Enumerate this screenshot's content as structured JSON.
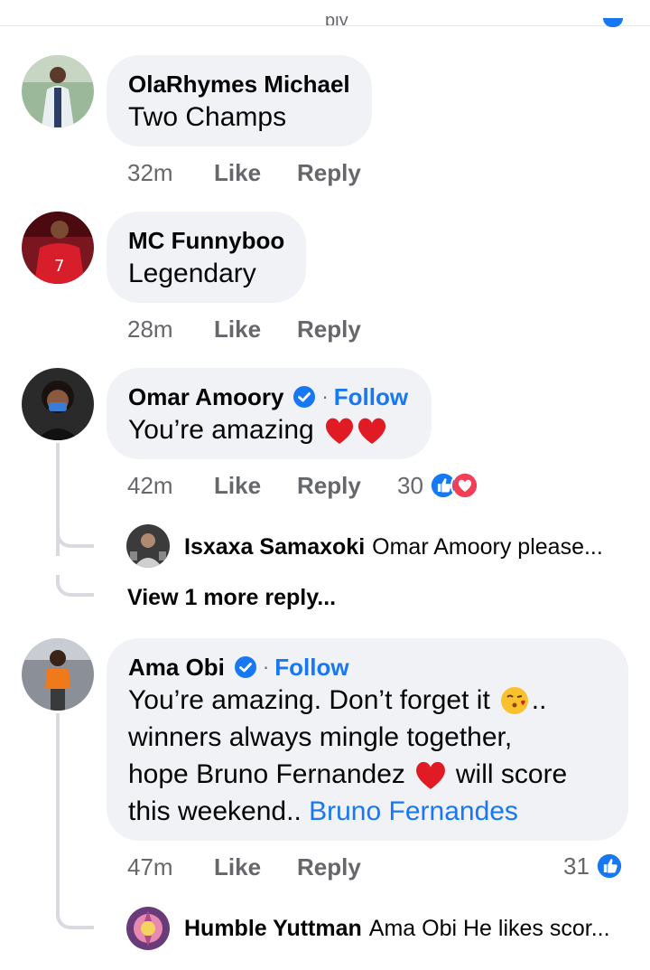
{
  "top": {
    "remnant_text": "ply"
  },
  "comments": [
    {
      "author": "OlaRhymes Michael",
      "text": "Two Champs",
      "time": "32m",
      "like": "Like",
      "reply": "Reply"
    },
    {
      "author": "MC Funnyboo",
      "text": "Legendary",
      "time": "28m",
      "like": "Like",
      "reply": "Reply"
    },
    {
      "author": "Omar Amoory",
      "verified": true,
      "separator": "·",
      "follow": "Follow",
      "text": "You’re amazing",
      "emoji": "❤❤",
      "time": "42m",
      "like": "Like",
      "reply": "Reply",
      "reaction_count": "30",
      "reactions": [
        "like",
        "love"
      ],
      "replies": [
        {
          "author": "Isxaxa Samaxoki",
          "snippet": "Omar Amoory please..."
        }
      ],
      "view_more": "View 1 more reply..."
    },
    {
      "author": "Ama Obi",
      "verified": true,
      "separator": "·",
      "follow": "Follow",
      "text_lines": [
        "You’re amazing. Don’t forget it",
        "winners always mingle together,",
        "hope Bruno Fernandez",
        "this weekend.."
      ],
      "line1_tail": "..",
      "line3_tail": "will score",
      "mention": "Bruno Fernandes",
      "time": "47m",
      "like": "Like",
      "reply": "Reply",
      "reaction_count": "31",
      "reactions": [
        "like"
      ],
      "replies": [
        {
          "author": "Humble Yuttman",
          "snippet": "Ama Obi He likes scor..."
        }
      ]
    }
  ],
  "colors": {
    "accent": "#1877f2",
    "bubble": "#f0f2f5",
    "meta": "#65676b",
    "love": "#f33e58"
  },
  "icons": [
    "verified-badge-icon",
    "like-reaction-icon",
    "love-reaction-icon",
    "heart-emoji-icon",
    "kiss-emoji-icon"
  ]
}
